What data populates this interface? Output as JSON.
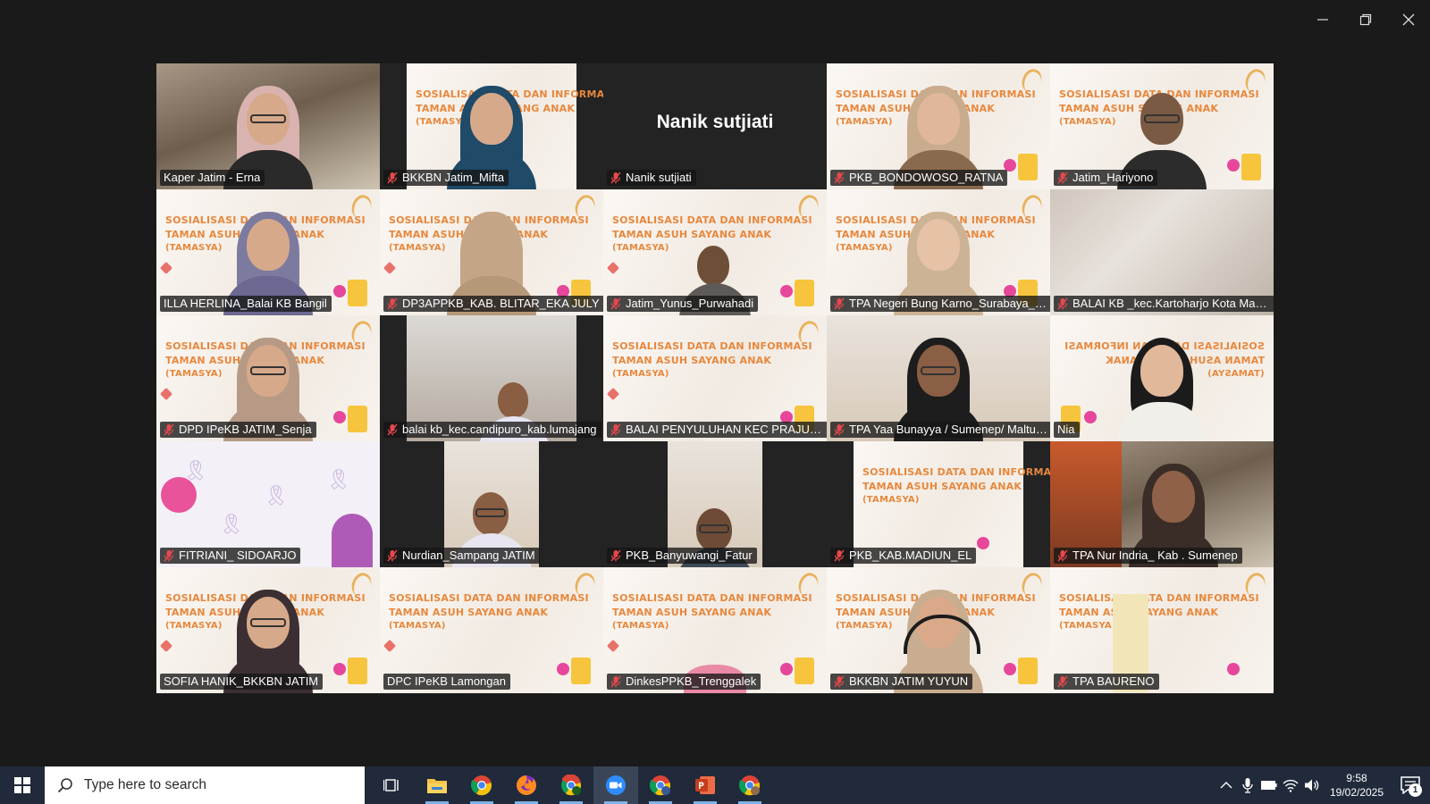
{
  "meeting": {
    "speaker_text": "Nanik sutjiati",
    "participants": [
      {
        "name": "Kaper Jatim - Erna",
        "muted": false
      },
      {
        "name": "BKKBN Jatim_Mifta",
        "muted": true
      },
      {
        "name": "Nanik sutjiati",
        "muted": true
      },
      {
        "name": "PKB_BONDOWOSO_RATNA",
        "muted": true
      },
      {
        "name": "Jatim_Hariyono",
        "muted": true
      },
      {
        "name": "ILLA HERLINA_Balai KB Bangil",
        "muted": false
      },
      {
        "name": "DP3APPKB_KAB. BLITAR_EKA JULY",
        "muted": true
      },
      {
        "name": "Jatim_Yunus_Purwahadi",
        "muted": true
      },
      {
        "name": "TPA Negeri Bung Karno_Surabaya_ima",
        "muted": true
      },
      {
        "name": "BALAI KB _kec.Kartoharjo Kota Madiun",
        "muted": true
      },
      {
        "name": "DPD IPeKB JATIM_Senja",
        "muted": true
      },
      {
        "name": "balai kb_kec.candipuro_kab.lumajang",
        "muted": true
      },
      {
        "name": "BALAI PENYULUHAN KEC PRAJURIT ...",
        "muted": true
      },
      {
        "name": "TPA Yaa Bunayya / Sumenep/ Maltuf...",
        "muted": true
      },
      {
        "name": "Nia",
        "muted": false
      },
      {
        "name": "FITRIANI_ SIDOARJO",
        "muted": true
      },
      {
        "name": "Nurdian_Sampang JATIM",
        "muted": true
      },
      {
        "name": "PKB_Banyuwangi_Fatur",
        "muted": true
      },
      {
        "name": "PKB_KAB.MADIUN_EL",
        "muted": true
      },
      {
        "name": "TPA Nur Indria_ Kab . Sumenep",
        "muted": true
      },
      {
        "name": "SOFIA HANIK_BKKBN JATIM",
        "muted": false
      },
      {
        "name": "DPC IPeKB Lamongan",
        "muted": false
      },
      {
        "name": "DinkesPPKB_Trenggalek",
        "muted": true
      },
      {
        "name": "BKKBN JATIM YUYUN",
        "muted": true
      },
      {
        "name": "TPA BAURENO",
        "muted": true
      }
    ],
    "banner": {
      "line1": "SOSIALISASI DATA DAN INFORMASI",
      "line2": "TAMAN ASUH SAYANG ANAK",
      "line3": "(TAMASYA)"
    }
  },
  "taskbar": {
    "search_placeholder": "Type here to search",
    "time": "9:58",
    "date": "19/02/2025",
    "notification_count": "1"
  },
  "colors": {
    "active_speaker": "#2fd36e",
    "muted_mic": "#e5484d",
    "taskbar": "#202a3a",
    "banner_text": "#e7883d"
  }
}
